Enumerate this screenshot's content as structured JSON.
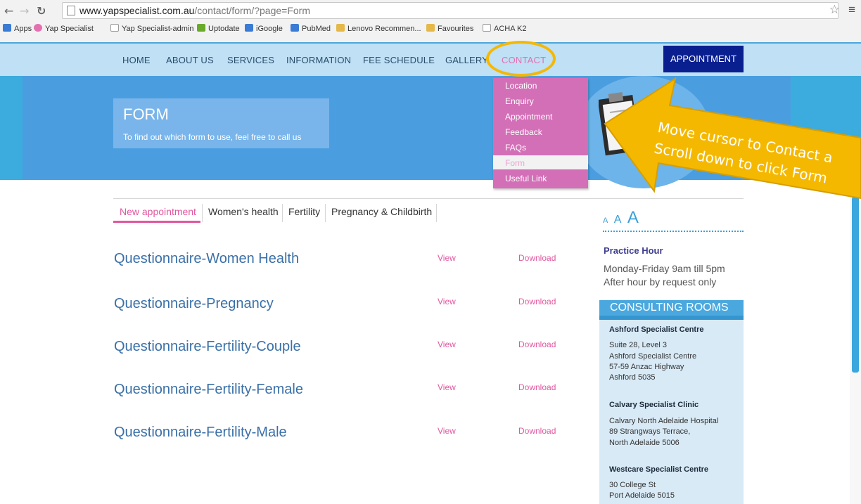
{
  "browser": {
    "url_host": "www.yapspecialist.com.au",
    "url_path": "/contact/form/?page=Form",
    "bookmarks": [
      {
        "label": "Apps",
        "color": "#3a7bd5"
      },
      {
        "label": "Yap Specialist",
        "color": "#e46fb1"
      },
      {
        "label": "Yap Specialist-admin",
        "color": "#cccccc"
      },
      {
        "label": "Uptodate",
        "color": "#6aaa2a"
      },
      {
        "label": "iGoogle",
        "color": "#3a7bd5"
      },
      {
        "label": "PubMed",
        "color": "#3a7bd5"
      },
      {
        "label": "Lenovo Recommen...",
        "color": "#e5b84a"
      },
      {
        "label": "Favourites",
        "color": "#e5b84a"
      },
      {
        "label": "ACHA K2",
        "color": "#cccccc"
      }
    ]
  },
  "nav": {
    "items": [
      "HOME",
      "ABOUT US",
      "SERVICES",
      "INFORMATION",
      "FEE SCHEDULE",
      "GALLERY",
      "CONTACT"
    ],
    "appointment": "APPOINTMENT"
  },
  "hero": {
    "title": "FORM",
    "subtitle": "To find out which form to use, feel free to call us"
  },
  "dropdown": {
    "items": [
      "Location",
      "Enquiry",
      "Appointment",
      "Feedback",
      "FAQs",
      "Form",
      "Useful Link"
    ]
  },
  "tabs": [
    "New appointment",
    "Women's health",
    "Fertility",
    "Pregnancy & Childbirth"
  ],
  "questionnaires": [
    {
      "title": "Questionnaire-Women Health",
      "view": "View",
      "download": "Download"
    },
    {
      "title": "Questionnaire-Pregnancy",
      "view": "View",
      "download": "Download"
    },
    {
      "title": "Questionnaire-Fertility-Couple",
      "view": "View",
      "download": "Download"
    },
    {
      "title": "Questionnaire-Fertility-Female",
      "view": "View",
      "download": "Download"
    },
    {
      "title": "Questionnaire-Fertility-Male",
      "view": "View",
      "download": "Download"
    }
  ],
  "sidebar": {
    "font_sizes": [
      "A",
      "A",
      "A"
    ],
    "practice_hour_title": "Practice Hour",
    "practice_hour_lines": [
      "Monday-Friday 9am till 5pm",
      "After hour by request only"
    ],
    "rooms_title": "CONSULTING ROOMS",
    "rooms": [
      {
        "name": "Ashford Specialist Centre",
        "lines": [
          "Suite 28, Level 3",
          "Ashford Specialist Centre",
          "57-59 Anzac Highway",
          "Ashford 5035"
        ]
      },
      {
        "name": "Calvary Specialist Clinic",
        "lines": [
          "Calvary North Adelaide Hospital",
          "89 Strangways Terrace,",
          "North Adelaide 5006"
        ]
      },
      {
        "name": "Westcare Specialist Centre",
        "lines": [
          "30 College St",
          "Port Adelaide 5015"
        ]
      }
    ]
  },
  "annotation": {
    "line1": "Move cursor to Contact a",
    "line2": "Scroll down to click Form",
    "color": "#f5b800"
  }
}
